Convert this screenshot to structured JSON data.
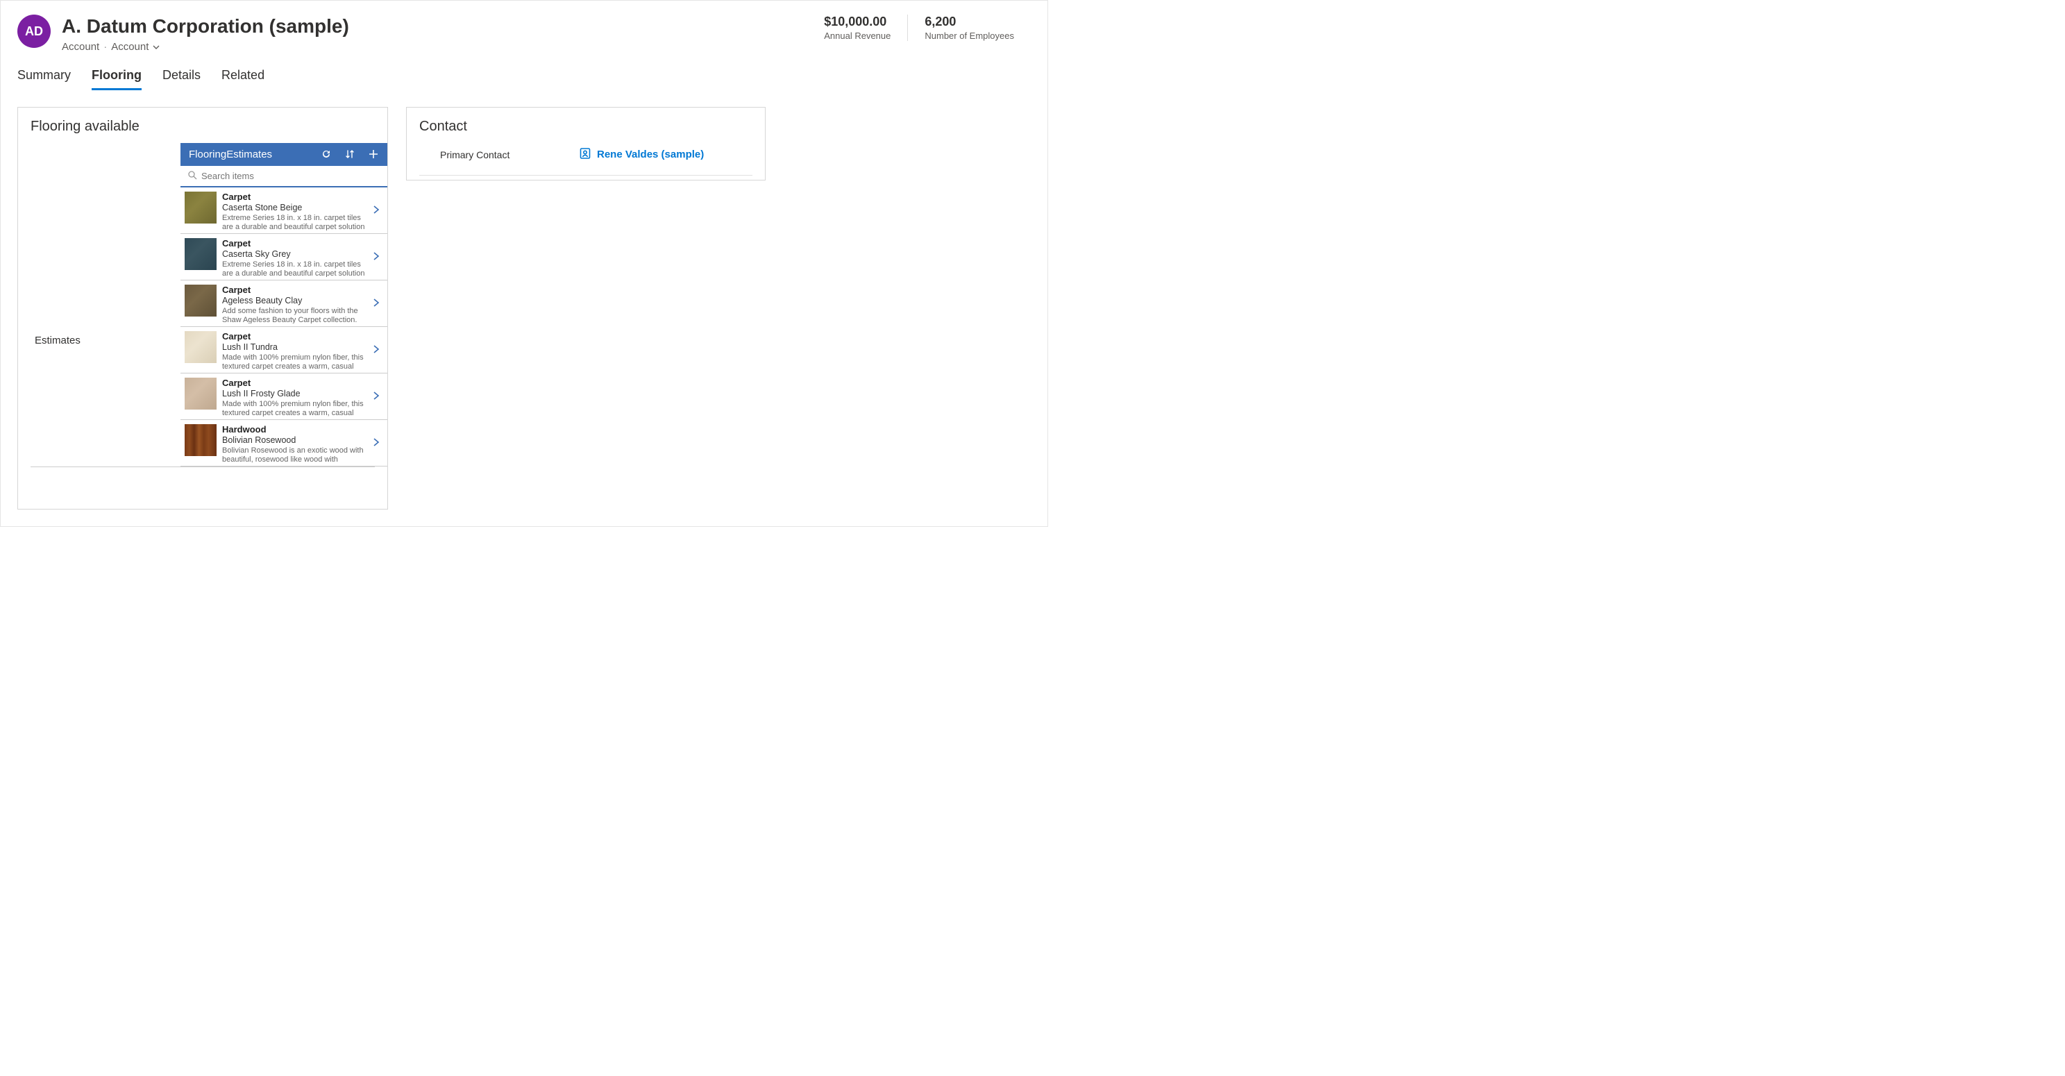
{
  "header": {
    "avatar_initials": "AD",
    "title": "A. Datum Corporation (sample)",
    "breadcrumb_entity": "Account",
    "breadcrumb_type": "Account"
  },
  "stats": {
    "revenue_value": "$10,000.00",
    "revenue_label": "Annual Revenue",
    "employees_value": "6,200",
    "employees_label": "Number of Employees"
  },
  "tabs": {
    "summary": "Summary",
    "flooring": "Flooring",
    "details": "Details",
    "related": "Related"
  },
  "flooring": {
    "section_title": "Flooring available",
    "side_label": "Estimates",
    "list_title": "FlooringEstimates",
    "search_placeholder": "Search items",
    "items": [
      {
        "category": "Carpet",
        "name": "Caserta Stone Beige",
        "desc": "Extreme Series 18 in. x 18 in. carpet tiles are a durable and beautiful carpet solution specially engineered for both",
        "swatch": "sw-beige"
      },
      {
        "category": "Carpet",
        "name": "Caserta Sky Grey",
        "desc": "Extreme Series 18 in. x 18 in. carpet tiles are a durable and beautiful carpet solution specially engineered for both",
        "swatch": "sw-grey"
      },
      {
        "category": "Carpet",
        "name": "Ageless Beauty Clay",
        "desc": "Add some fashion to your floors with the Shaw Ageless Beauty Carpet collection.",
        "swatch": "sw-clay"
      },
      {
        "category": "Carpet",
        "name": "Lush II Tundra",
        "desc": "Made with 100% premium nylon fiber, this textured carpet creates a warm, casual atmosphere that invites you to",
        "swatch": "sw-tundra"
      },
      {
        "category": "Carpet",
        "name": "Lush II Frosty Glade",
        "desc": "Made with 100% premium nylon fiber, this textured carpet creates a warm, casual atmosphere that invites you to",
        "swatch": "sw-frosty"
      },
      {
        "category": "Hardwood",
        "name": "Bolivian Rosewood",
        "desc": "Bolivian Rosewood is an exotic wood with beautiful, rosewood like wood with",
        "swatch": "sw-wood"
      }
    ]
  },
  "contact": {
    "section_title": "Contact",
    "label": "Primary Contact",
    "value": "Rene Valdes (sample)"
  }
}
